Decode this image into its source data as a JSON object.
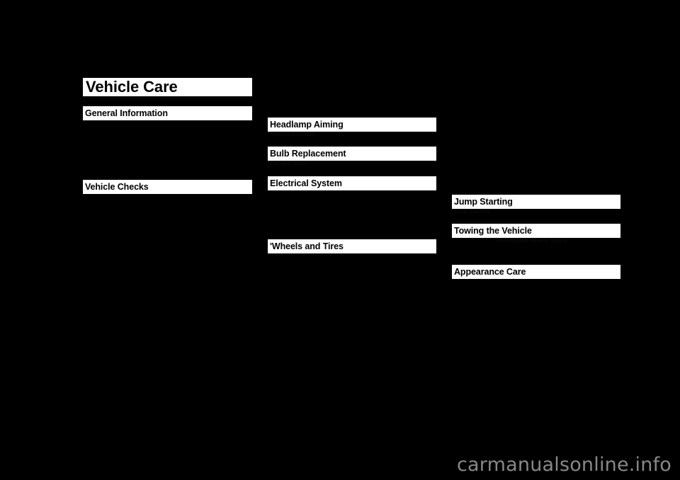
{
  "document": {
    "chapter_title": "Vehicle Care",
    "watermark": "carmanualsonline.info"
  },
  "columns": [
    {
      "name": "left-column",
      "sections": [
        {
          "label": "General Information",
          "ghost": ""
        },
        {
          "label": "Vehicle Checks",
          "ghost": ""
        }
      ]
    },
    {
      "name": "middle-column",
      "sections": [
        {
          "label": "Headlamp Aiming",
          "ghost": "Headlamp Aiming"
        },
        {
          "label": "Bulb Replacement",
          "ghost": "Halogen Bulbs"
        },
        {
          "label": "Electrical System",
          "ghost": ""
        },
        {
          "label": "'Wheels and Tires",
          "ghost": ""
        }
      ]
    },
    {
      "name": "right-column",
      "sections": [
        {
          "label": "Jump Starting",
          "ghost": "Jump Starting"
        },
        {
          "label": "Towing the Vehicle",
          "ghost": "Recreational Vehicle Towing"
        },
        {
          "label": "Appearance Care",
          "ghost": ""
        }
      ]
    }
  ]
}
